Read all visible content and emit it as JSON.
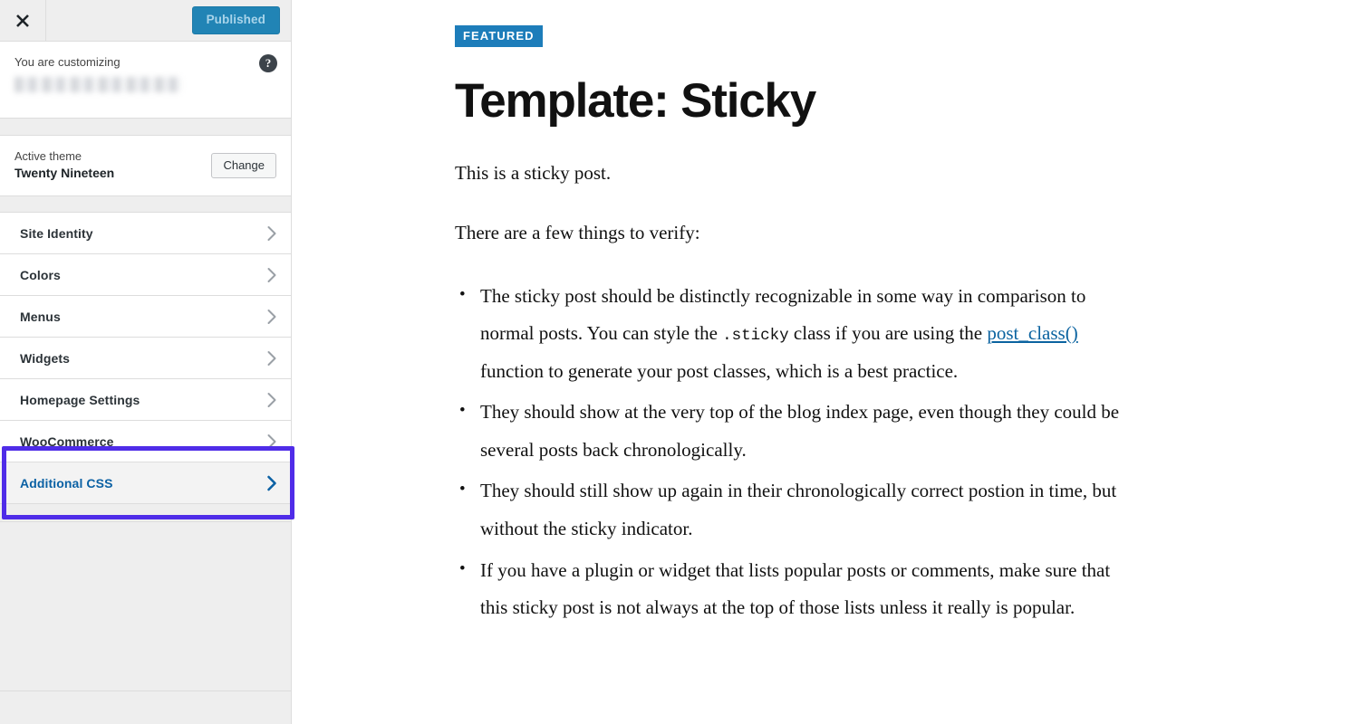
{
  "sidebar": {
    "topbar": {
      "close_icon": "close-x-icon",
      "publish_label": "Published"
    },
    "info": {
      "customizing_label": "You are customizing",
      "site_name": "",
      "help_icon": "question-mark-icon",
      "help_glyph": "?"
    },
    "theme": {
      "active_theme_label": "Active theme",
      "theme_name": "Twenty Nineteen",
      "change_label": "Change"
    },
    "panels": [
      {
        "label": "Site Identity",
        "active": false,
        "chevron_icon": "chevron-right-icon"
      },
      {
        "label": "Colors",
        "active": false,
        "chevron_icon": "chevron-right-icon"
      },
      {
        "label": "Menus",
        "active": false,
        "chevron_icon": "chevron-right-icon"
      },
      {
        "label": "Widgets",
        "active": false,
        "chevron_icon": "chevron-right-icon"
      },
      {
        "label": "Homepage Settings",
        "active": false,
        "chevron_icon": "chevron-right-icon"
      },
      {
        "label": "WooCommerce",
        "active": false,
        "chevron_icon": "chevron-right-icon"
      },
      {
        "label": "Additional CSS",
        "active": true,
        "chevron_icon": "chevron-right-icon"
      }
    ]
  },
  "annotation": {
    "target_label": "Additional CSS",
    "border_color": "#4f2ce8"
  },
  "preview": {
    "badge": "FEATURED",
    "title": "Template: Sticky",
    "paragraphs": [
      "This is a sticky post.",
      "There are a few things to verify:"
    ],
    "list": [
      {
        "part1": "The sticky post should be distinctly recognizable in some way in comparison to normal posts. You can style the ",
        "code": ".sticky",
        "part2": " class if you are using the ",
        "link": "post_class()",
        "part3": " function to generate your post classes, which is a best practice."
      },
      {
        "part1": "They should show at the very top of the blog index page, even though they could be several posts back chronologically.",
        "code": "",
        "part2": "",
        "link": "",
        "part3": ""
      },
      {
        "part1": "They should still show up again in their chronologically correct postion in time, but without the sticky indicator.",
        "code": "",
        "part2": "",
        "link": "",
        "part3": ""
      },
      {
        "part1": "If you have a plugin or widget that lists popular posts or comments, make sure that this sticky post is not always at the top of those lists unless it really is popular.",
        "code": "",
        "part2": "",
        "link": "",
        "part3": ""
      }
    ]
  },
  "colors": {
    "publish_button": "#2184b5",
    "badge": "#1d7dba",
    "active_panel_text": "#0b61a4",
    "link": "#0b63a0",
    "highlight": "#4f2ce8"
  }
}
